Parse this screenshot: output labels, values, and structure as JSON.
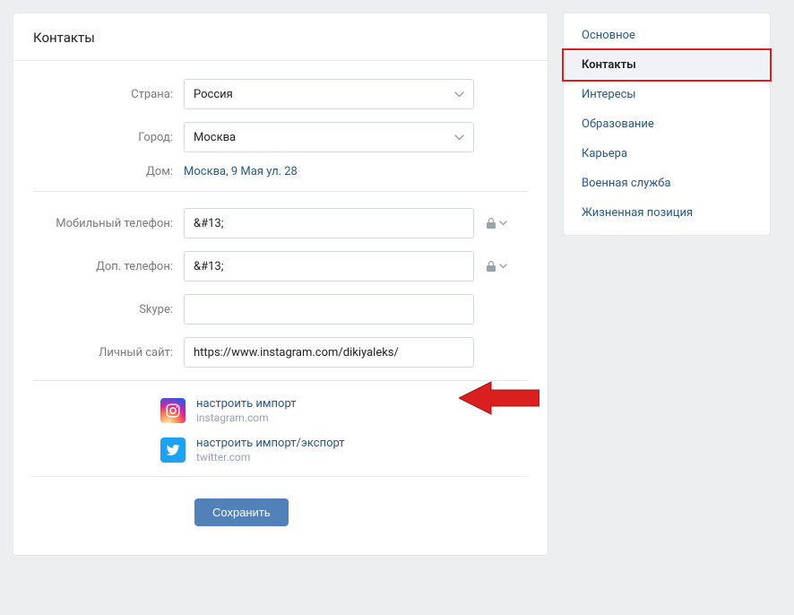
{
  "header": {
    "title": "Контакты"
  },
  "form": {
    "country_label": "Страна:",
    "country_value": "Россия",
    "city_label": "Город:",
    "city_value": "Москва",
    "home_label": "Дом:",
    "home_value": "Москва, 9 Мая ул. 28",
    "mobile_label": "Мобильный телефон:",
    "mobile_value": "&#13;",
    "altphone_label": "Доп. телефон:",
    "altphone_value": "&#13;",
    "skype_label": "Skype:",
    "skype_value": "",
    "website_label": "Личный сайт:",
    "website_value": "https://www.instagram.com/dikiyaleks/"
  },
  "social": {
    "instagram_action": "настроить импорт",
    "instagram_domain": "instagram.com",
    "twitter_action": "настроить импорт/экспорт",
    "twitter_domain": "twitter.com"
  },
  "actions": {
    "save_label": "Сохранить"
  },
  "sidebar": {
    "items": [
      {
        "label": "Основное"
      },
      {
        "label": "Контакты"
      },
      {
        "label": "Интересы"
      },
      {
        "label": "Образование"
      },
      {
        "label": "Карьера"
      },
      {
        "label": "Военная служба"
      },
      {
        "label": "Жизненная позиция"
      }
    ],
    "active_index": 1
  }
}
